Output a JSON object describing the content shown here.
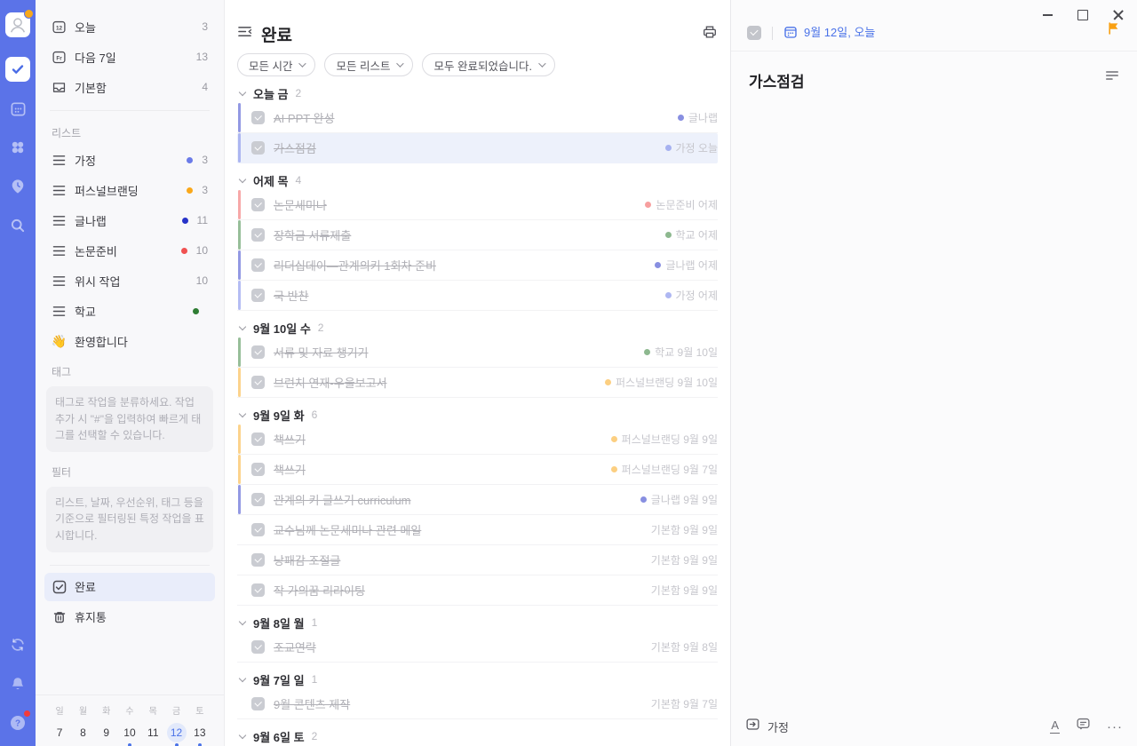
{
  "colors": {
    "rail": "#5b73e8",
    "accent": "#4a72e8",
    "flag_orange": "#f9a013",
    "list_colors": {
      "가정": "#6b7be8",
      "퍼스널브랜딩": "#faa81a",
      "글나랩": "#2733c8",
      "논문준비": "#f05151",
      "학교": "#2f7d33"
    }
  },
  "rail_icons": [
    "avatar",
    "tasks-check-icon",
    "calendar-icon",
    "quadrant-icon",
    "habit-clock-icon",
    "search-icon",
    "sync-icon",
    "notification-bell-icon",
    "help-icon"
  ],
  "sidebar": {
    "top_items": [
      {
        "icon": "calendar-today-icon",
        "icon_text": "12",
        "label": "오늘",
        "count": "3"
      },
      {
        "icon": "calendar-week-icon",
        "icon_text": "Fr",
        "label": "다음 7일",
        "count": "13"
      },
      {
        "icon": "inbox-icon",
        "icon_text": "",
        "label": "기본함",
        "count": "4"
      }
    ],
    "lists_label": "리스트",
    "lists": [
      {
        "label": "가정",
        "color": "#6b7be8",
        "count": "3"
      },
      {
        "label": "퍼스널브랜딩",
        "color": "#faa81a",
        "count": "3"
      },
      {
        "label": "글나랩",
        "color": "#2733c8",
        "count": "11"
      },
      {
        "label": "논문준비",
        "color": "#f05151",
        "count": "10"
      },
      {
        "label": "위시 작업",
        "color": "",
        "count": "10"
      },
      {
        "label": "학교",
        "color": "#2f7d33",
        "count": ""
      }
    ],
    "welcome": {
      "emoji": "👋",
      "label": "환영합니다"
    },
    "tags_label": "태그",
    "tags_hint": "태그로 작업을 분류하세요. 작업 추가 시 \"#\"을 입력하여 빠르게 태그를 선택할 수 있습니다.",
    "filter_label": "필터",
    "filter_hint": "리스트, 날짜, 우선순위, 태그 등을 기준으로 필터링된 특정 작업을 표시합니다.",
    "completed_label": "완료",
    "trash_label": "휴지통",
    "mini_calendar": {
      "day_headers": [
        "일",
        "월",
        "화",
        "수",
        "목",
        "금",
        "토"
      ],
      "dates": [
        "7",
        "8",
        "9",
        "10",
        "11",
        "12",
        "13"
      ],
      "selected": "12",
      "dotted": [
        "10",
        "12",
        "13"
      ]
    }
  },
  "main": {
    "title": "완료",
    "filters": [
      "모든 시간",
      "모든 리스트",
      "모두 완료되었습니다."
    ],
    "groups": [
      {
        "label": "오늘 금",
        "count": "2",
        "tasks": [
          {
            "title": "AI PPT 완성",
            "list": "글나랩",
            "date": "",
            "selected": false
          },
          {
            "title": "가스점검",
            "list": "가정",
            "date": "오늘",
            "selected": true
          }
        ]
      },
      {
        "label": "어제 목",
        "count": "4",
        "tasks": [
          {
            "title": "논문세미나",
            "list": "논문준비",
            "date": "어제",
            "selected": false
          },
          {
            "title": "장학금 서류제출",
            "list": "학교",
            "date": "어제",
            "selected": false
          },
          {
            "title": "리더십데이—관계의키 1회차 준비",
            "list": "글나랩",
            "date": "어제",
            "selected": false
          },
          {
            "title": "국 반찬",
            "list": "가정",
            "date": "어제",
            "selected": false
          }
        ]
      },
      {
        "label": "9월 10일 수",
        "count": "2",
        "tasks": [
          {
            "title": "서류 및 자료 챙기기",
            "list": "학교",
            "date": "9월 10일",
            "selected": false
          },
          {
            "title": "브런치 연재-우울보고서",
            "list": "퍼스널브랜딩",
            "date": "9월 10일",
            "selected": false
          }
        ]
      },
      {
        "label": "9월 9일 화",
        "count": "6",
        "tasks": [
          {
            "title": "책쓰기",
            "list": "퍼스널브랜딩",
            "date": "9월 9일",
            "selected": false
          },
          {
            "title": "책쓰기",
            "list": "퍼스널브랜딩",
            "date": "9월 7일",
            "selected": false
          },
          {
            "title": "관계의 키 글쓰기 curriculum",
            "list": "글나랩",
            "date": "9월 9일",
            "selected": false
          },
          {
            "title": "교수님께 논문세미나 관련 메일",
            "list": "기본함",
            "date": "9월 9일",
            "selected": false
          },
          {
            "title": "낭패감 조절글",
            "list": "기본함",
            "date": "9월 9일",
            "selected": false
          },
          {
            "title": "작 가의꿈 리라이팅",
            "list": "기본함",
            "date": "9월 9일",
            "selected": false
          }
        ]
      },
      {
        "label": "9월 8일 월",
        "count": "1",
        "tasks": [
          {
            "title": "조교연락",
            "list": "기본함",
            "date": "9월 8일",
            "selected": false
          }
        ]
      },
      {
        "label": "9월 7일 일",
        "count": "1",
        "tasks": [
          {
            "title": "9월 콘텐츠 제작",
            "list": "기본함",
            "date": "9월 7일",
            "selected": false
          }
        ]
      },
      {
        "label": "9월 6일 토",
        "count": "2",
        "tasks": []
      }
    ]
  },
  "detail": {
    "date_label": "9월 12일, 오늘",
    "title": "가스점검",
    "footer_list": "가정",
    "more_label": "···"
  }
}
